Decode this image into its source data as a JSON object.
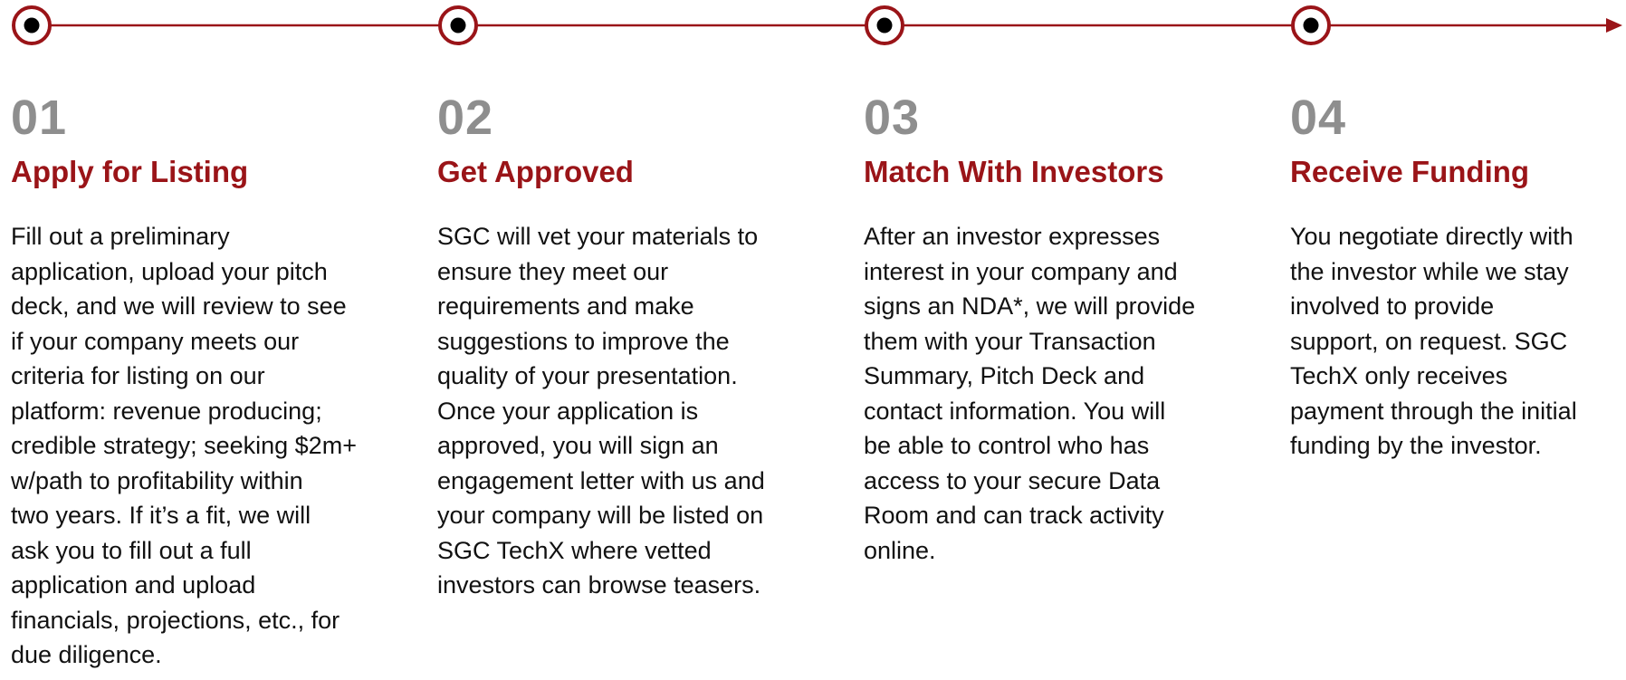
{
  "colors": {
    "accent": "#9a1418",
    "number": "#8e8e8e",
    "text": "#111111"
  },
  "steps": [
    {
      "number": "01",
      "title": "Apply for Listing",
      "lines": [
        "Fill out a preliminary",
        "application, upload your pitch",
        "deck, and we will review to see",
        "if your company meets our",
        "criteria for listing on our",
        "platform: revenue producing;",
        "credible strategy; seeking $2m+",
        "w/path to profitability within",
        "two years. If it’s a fit, we will",
        "ask you to fill out a full",
        "application and upload",
        "financials, projections, etc., for",
        "due diligence."
      ]
    },
    {
      "number": "02",
      "title": "Get Approved",
      "lines": [
        "SGC will vet your materials to",
        "ensure they meet our",
        "requirements and make",
        "suggestions to improve the",
        "quality of your presentation.",
        "Once your application is",
        "approved, you will sign an",
        "engagement letter with us and",
        "your company will be listed on",
        "SGC TechX where vetted",
        "investors can browse teasers."
      ]
    },
    {
      "number": "03",
      "title": "Match With Investors",
      "lines": [
        "After an investor expresses",
        "interest in your company and",
        "signs an NDA*, we will provide",
        "them with your Transaction",
        "Summary, Pitch Deck and",
        "contact information. You will",
        "be able to control who has",
        "access to your secure Data",
        "Room and can track activity",
        "online."
      ]
    },
    {
      "number": "04",
      "title": "Receive Funding",
      "lines": [
        "You negotiate directly with",
        "the investor while we stay",
        "involved to provide",
        "support, on request. SGC",
        "TechX only receives",
        "payment through the initial",
        "funding by the investor."
      ]
    }
  ]
}
